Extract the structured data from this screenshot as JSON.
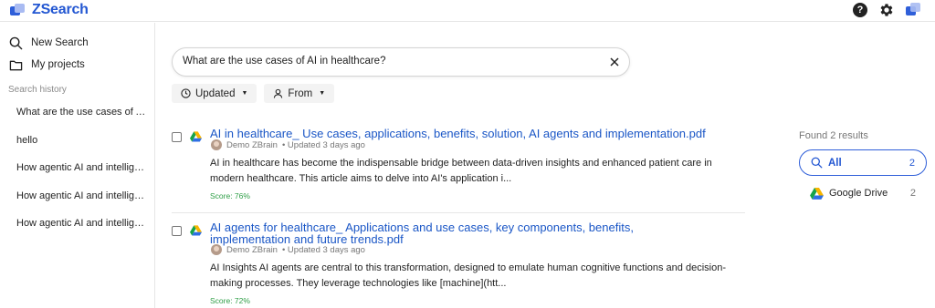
{
  "app": {
    "name": "ZSearch"
  },
  "icons": {
    "logo": "zsearch-logo-icon",
    "help": "help-icon",
    "settings": "gear-icon",
    "apps": "apps-icon",
    "new_search": "search-icon",
    "projects": "folder-icon",
    "clear": "close-icon",
    "updated": "clock-icon",
    "from": "person-icon",
    "source": "google-drive-icon"
  },
  "colors": {
    "brand": "#2357d2",
    "link": "#1a56c6",
    "score": "#2e9e46"
  },
  "sidebar": {
    "nav": [
      {
        "label": "New Search"
      },
      {
        "label": "My projects"
      }
    ],
    "history_label": "Search history",
    "history": [
      {
        "label": "What are the use cases of AI in healthcare?"
      },
      {
        "label": "hello"
      },
      {
        "label": "How agentic AI and intelligent automation"
      },
      {
        "label": "How agentic AI and intelligent automation"
      },
      {
        "label": "How agentic AI and intelligent automation"
      }
    ]
  },
  "search": {
    "query": "What are the use cases of AI in healthcare?"
  },
  "filters": {
    "updated": "Updated",
    "from": "From"
  },
  "results": [
    {
      "title": "AI in healthcare_ Use cases, applications, benefits, solution, AI agents and implementation.pdf",
      "author": "Demo ZBrain",
      "updated": "• Updated 3 days ago",
      "snippet": "AI in healthcare has become the indispensable bridge between data-driven insights and enhanced patient care in modern healthcare. This article aims to delve into AI's application i...",
      "score": "Score: 76%"
    },
    {
      "title": "AI agents for healthcare_ Applications and use cases, key components, benefits, implementation and future trends.pdf",
      "author": "Demo ZBrain",
      "updated": "• Updated 3 days ago",
      "snippet": "AI Insights AI agents are central to this transformation, designed to emulate human cognitive functions and decision-making processes. They leverage technologies like [machine](htt...",
      "score": "Score: 72%"
    }
  ],
  "summary": {
    "found": "Found 2 results",
    "sources": [
      {
        "label": "All",
        "count": "2"
      },
      {
        "label": "Google Drive",
        "count": "2"
      }
    ]
  }
}
